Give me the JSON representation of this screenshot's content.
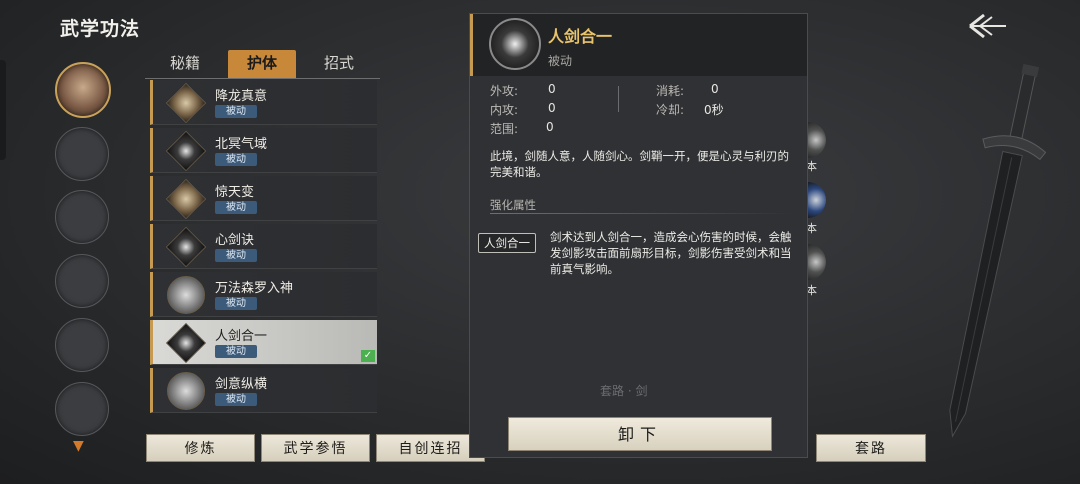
{
  "header": {
    "title": "武学功法"
  },
  "tabs": [
    {
      "label": "秘籍",
      "active": false
    },
    {
      "label": "护体",
      "active": true
    },
    {
      "label": "招式",
      "active": false
    }
  ],
  "skills": [
    {
      "name": "降龙真意",
      "tag": "被动",
      "icon": "dragon-scroll-icon"
    },
    {
      "name": "北冥气域",
      "tag": "被动",
      "icon": "qi-field-icon"
    },
    {
      "name": "惊天变",
      "tag": "被动",
      "icon": "storm-icon"
    },
    {
      "name": "心剑诀",
      "tag": "被动",
      "icon": "heart-sword-icon"
    },
    {
      "name": "万法森罗入神",
      "tag": "被动",
      "icon": "myriad-arts-icon"
    },
    {
      "name": "人剑合一",
      "tag": "被动",
      "icon": "sword-unity-icon",
      "selected": true
    },
    {
      "name": "剑意纵横",
      "tag": "被动",
      "icon": "sword-intent-icon"
    }
  ],
  "bottom_buttons": {
    "cultivate": "修炼",
    "comprehend": "武学参悟",
    "custom_combo": "自创连招",
    "routine": "套路"
  },
  "detail": {
    "name": "人剑合一",
    "type": "被动",
    "stats": {
      "outer_attack_label": "外攻:",
      "outer_attack": "0",
      "inner_attack_label": "内攻:",
      "inner_attack": "0",
      "range_label": "范围:",
      "range": "0",
      "cost_label": "消耗:",
      "cost": "0",
      "cooldown_label": "冷却:",
      "cooldown": "0秒"
    },
    "description": "此境，剑随人意，人随剑心。剑鞘一开，便是心灵与利刃的完美和谐。",
    "enhance_title": "强化属性",
    "enhance_tag": "人剑合一",
    "enhance_desc": "剑术达到人剑合一，造成会心伤害的时候，会触发剑影攻击面前扇形目标，剑影伤害受剑术和当前真气影响。",
    "faded_text": "套路 · 剑",
    "unload_label": "卸下"
  },
  "side_labels": [
    "本",
    "本",
    "本"
  ],
  "colors": {
    "accent": "#c8883a",
    "gold_text": "#e9c46a",
    "tag_blue": "#3c5a7a"
  }
}
